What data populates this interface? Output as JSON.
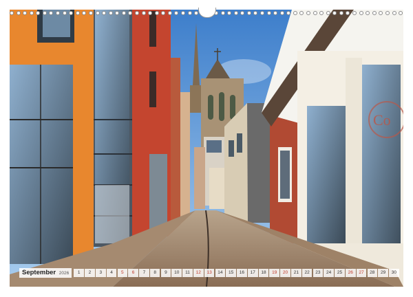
{
  "calendar": {
    "month": "September",
    "year": "2026",
    "days": [
      {
        "n": "1",
        "w": false
      },
      {
        "n": "2",
        "w": false
      },
      {
        "n": "3",
        "w": false
      },
      {
        "n": "4",
        "w": false
      },
      {
        "n": "5",
        "w": true
      },
      {
        "n": "6",
        "w": true
      },
      {
        "n": "7",
        "w": false
      },
      {
        "n": "8",
        "w": false
      },
      {
        "n": "9",
        "w": false
      },
      {
        "n": "10",
        "w": false
      },
      {
        "n": "11",
        "w": false
      },
      {
        "n": "12",
        "w": true
      },
      {
        "n": "13",
        "w": true
      },
      {
        "n": "14",
        "w": false
      },
      {
        "n": "15",
        "w": false
      },
      {
        "n": "16",
        "w": false
      },
      {
        "n": "17",
        "w": false
      },
      {
        "n": "18",
        "w": false
      },
      {
        "n": "19",
        "w": true
      },
      {
        "n": "20",
        "w": true
      },
      {
        "n": "21",
        "w": false
      },
      {
        "n": "22",
        "w": false
      },
      {
        "n": "23",
        "w": false
      },
      {
        "n": "24",
        "w": false
      },
      {
        "n": "25",
        "w": false
      },
      {
        "n": "26",
        "w": true
      },
      {
        "n": "27",
        "w": true
      },
      {
        "n": "28",
        "w": false
      },
      {
        "n": "29",
        "w": false
      },
      {
        "n": "30",
        "w": false
      }
    ],
    "weekend_color": "#c0392b"
  },
  "photo": {
    "shop_sign": "Co"
  },
  "colors": {
    "sky": "#4f8fd6",
    "orange_wall": "#e8872e",
    "red_brick": "#c4452f",
    "cobblestone": "#9a7f66",
    "church": "#a89275"
  }
}
